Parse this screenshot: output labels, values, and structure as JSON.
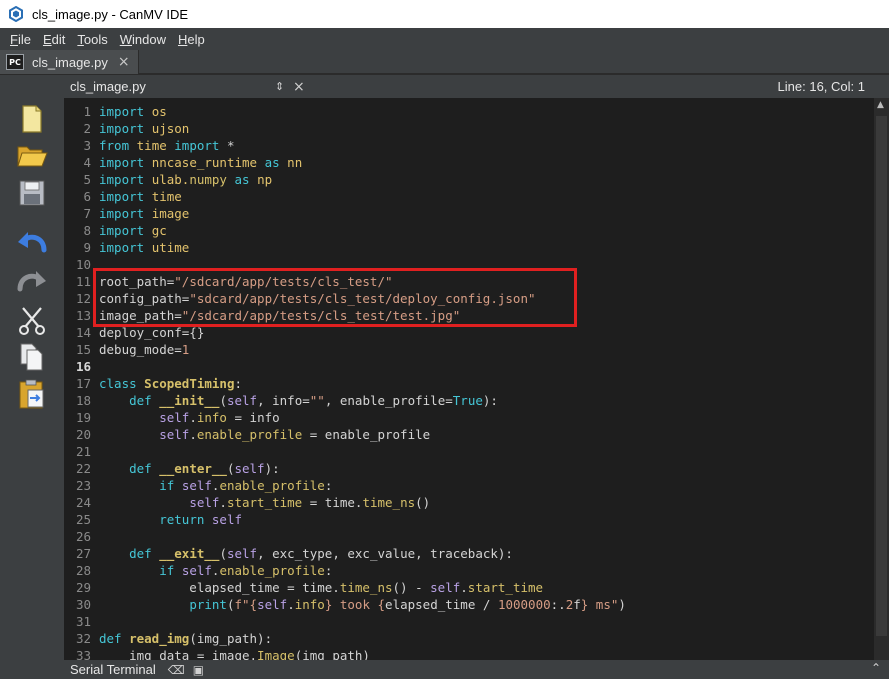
{
  "window": {
    "title": "cls_image.py - CanMV IDE"
  },
  "menu": [
    {
      "label": "File",
      "ul": "F",
      "rest": "ile"
    },
    {
      "label": "Edit",
      "ul": "E",
      "rest": "dit"
    },
    {
      "label": "Tools",
      "ul": "T",
      "rest": "ools"
    },
    {
      "label": "Window",
      "ul": "W",
      "rest": "indow"
    },
    {
      "label": "Help",
      "ul": "H",
      "rest": "elp"
    }
  ],
  "file_tab": {
    "badge": "PC",
    "label": "cls_image.py",
    "close": "×"
  },
  "toolbar": [
    "new-file",
    "open-file",
    "save-file",
    "undo",
    "redo",
    "cut",
    "copy",
    "paste"
  ],
  "editor": {
    "doc_name": "cls_image.py",
    "doc_arrows": "⇕",
    "doc_close": "×",
    "cursor_position": "Line: 16, Col: 1",
    "current_line": 16
  },
  "code_lines": [
    "import os",
    "import ujson",
    "from time import *",
    "import nncase_runtime as nn",
    "import ulab.numpy as np",
    "import time",
    "import image",
    "import gc",
    "import utime",
    "",
    "root_path=\"/sdcard/app/tests/cls_test/\"",
    "config_path=\"sdcard/app/tests/cls_test/deploy_config.json\"",
    "image_path=\"/sdcard/app/tests/cls_test/test.jpg\"",
    "deploy_conf={}",
    "debug_mode=1",
    "",
    "class ScopedTiming:",
    "    def __init__(self, info=\"\", enable_profile=True):",
    "        self.info = info",
    "        self.enable_profile = enable_profile",
    "",
    "    def __enter__(self):",
    "        if self.enable_profile:",
    "            self.start_time = time.time_ns()",
    "        return self",
    "",
    "    def __exit__(self, exc_type, exc_value, traceback):",
    "        if self.enable_profile:",
    "            elapsed_time = time.time_ns() - self.start_time",
    "            print(f\"{self.info} took {elapsed_time / 1000000:.2f} ms\")",
    "",
    "def read_img(img_path):",
    "    img_data = image.Image(img_path)"
  ],
  "bottom_panel": {
    "label": "Serial Terminal"
  },
  "colors": {
    "keyword": "#45c6d6",
    "string": "#d69d85",
    "self": "#b9a2e5",
    "highlight_box": "#e02020"
  }
}
